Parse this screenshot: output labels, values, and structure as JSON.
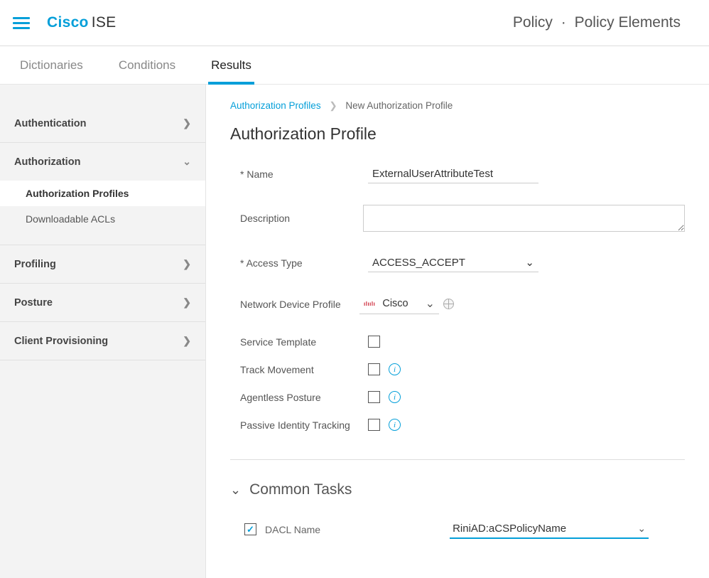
{
  "brand": {
    "cisco": "Cisco",
    "ise": "ISE"
  },
  "top_breadcrumb": {
    "a": "Policy",
    "b": "Policy Elements",
    "sep": "·"
  },
  "tabs": {
    "dictionaries": "Dictionaries",
    "conditions": "Conditions",
    "results": "Results"
  },
  "sidebar": {
    "authentication": "Authentication",
    "authorization": "Authorization",
    "auth_profiles": "Authorization Profiles",
    "dacls": "Downloadable ACLs",
    "profiling": "Profiling",
    "posture": "Posture",
    "client_prov": "Client Provisioning"
  },
  "page_crumb": {
    "parent": "Authorization Profiles",
    "current": "New Authorization Profile"
  },
  "page_title": "Authorization Profile",
  "form": {
    "name_label": "* Name",
    "name_value": "ExternalUserAttributeTest",
    "description_label": "Description",
    "description_value": "",
    "access_type_label": "* Access Type",
    "access_type_value": "ACCESS_ACCEPT",
    "ndp_label": "Network Device Profile",
    "ndp_value": "Cisco",
    "service_template_label": "Service Template",
    "track_movement_label": "Track Movement",
    "agentless_posture_label": "Agentless Posture",
    "passive_identity_label": "Passive Identity Tracking"
  },
  "section": {
    "title": "Common Tasks"
  },
  "task": {
    "dacl_label": "DACL Name",
    "dacl_value": "RiniAD:aCSPolicyName"
  }
}
